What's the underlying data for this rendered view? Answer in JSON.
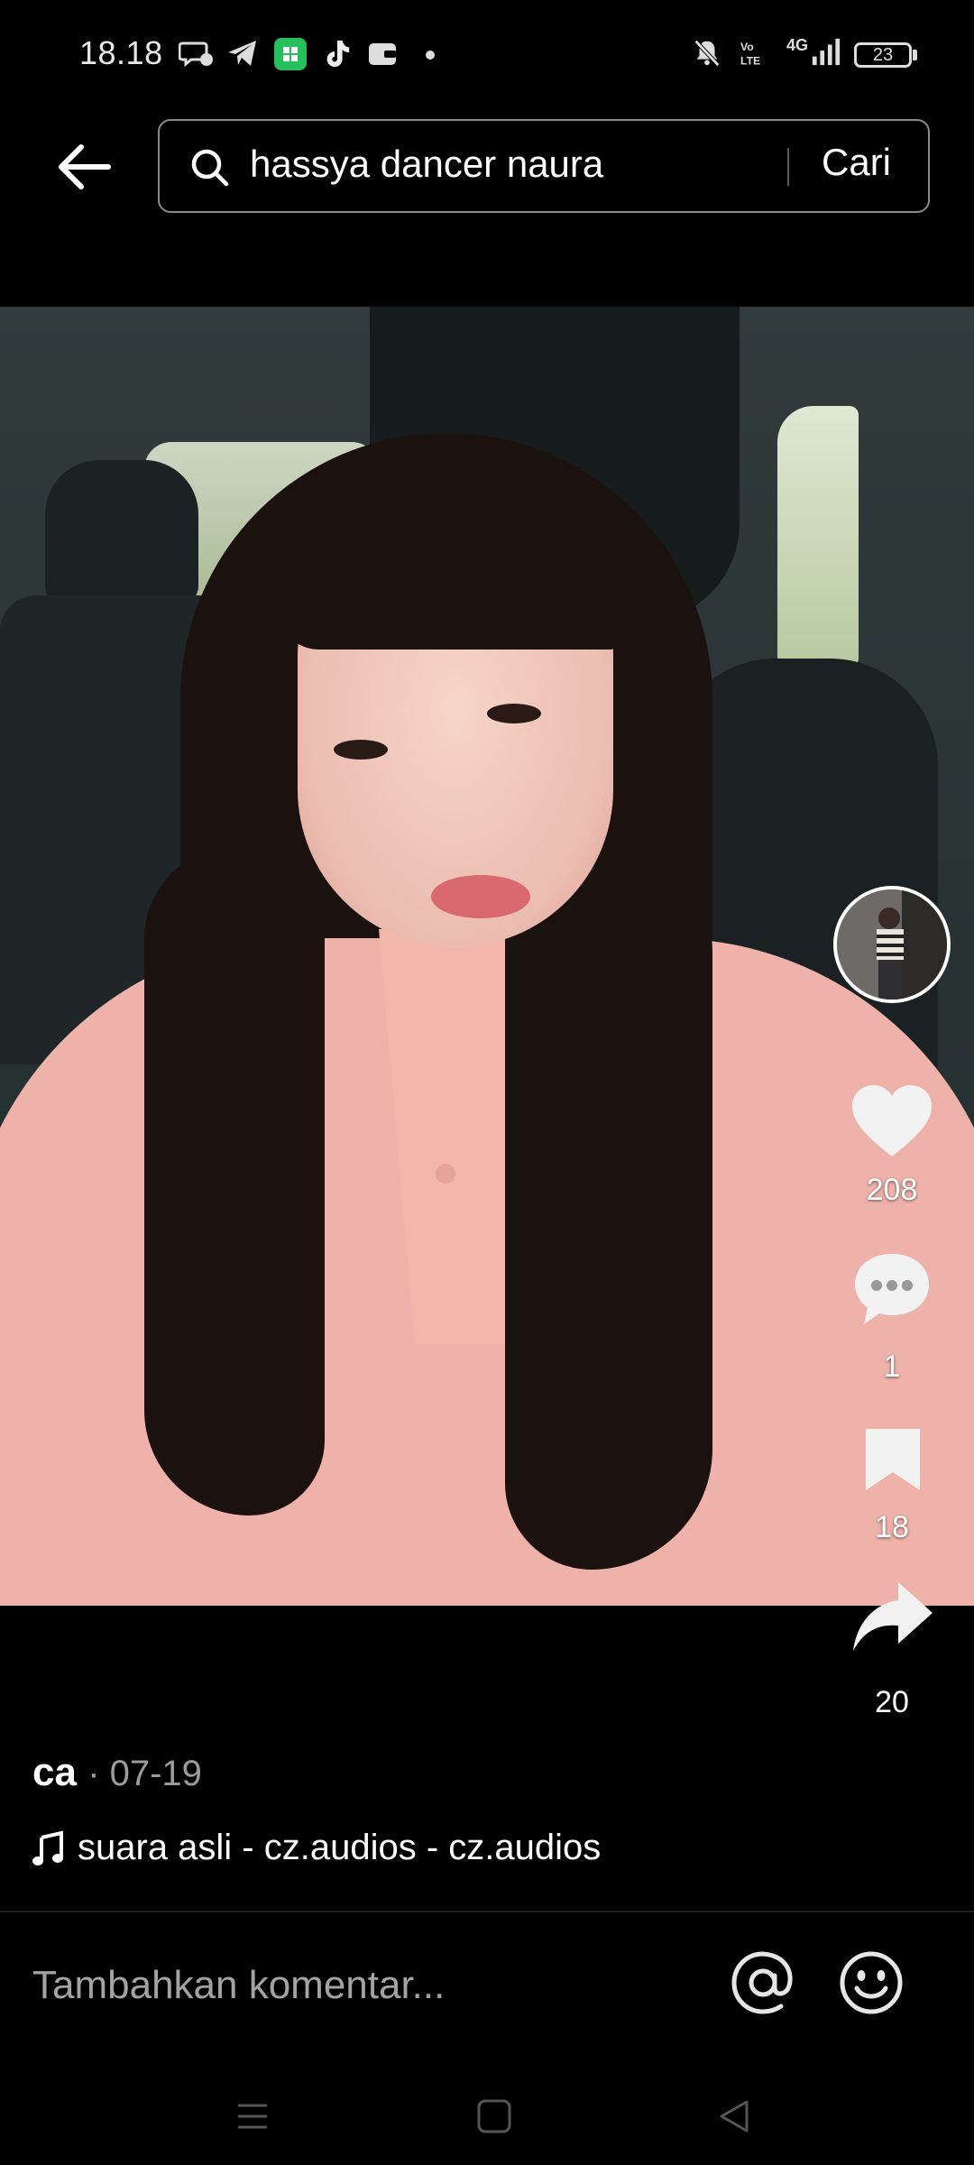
{
  "status_bar": {
    "time": "18.18",
    "network_label": "4G",
    "battery_level": "23"
  },
  "search": {
    "query": "hassya dancer naura",
    "submit_label": "Cari"
  },
  "actions": {
    "likes": "208",
    "comments": "1",
    "saves": "18",
    "shares": "20"
  },
  "post": {
    "author": "ca",
    "date": "· 07-19",
    "sound": "suara asli - cz.audios - cz.audios"
  },
  "comment_input": {
    "placeholder": "Tambahkan komentar..."
  },
  "colors": {
    "background": "#000000",
    "secondary_text": "#a3a3a3",
    "tiktok_green": "#25c05b"
  },
  "icons": [
    "back-arrow-icon",
    "search-icon",
    "heart-icon",
    "comment-icon",
    "bookmark-icon",
    "share-icon",
    "music-note-icon",
    "at-icon",
    "emoji-icon"
  ]
}
